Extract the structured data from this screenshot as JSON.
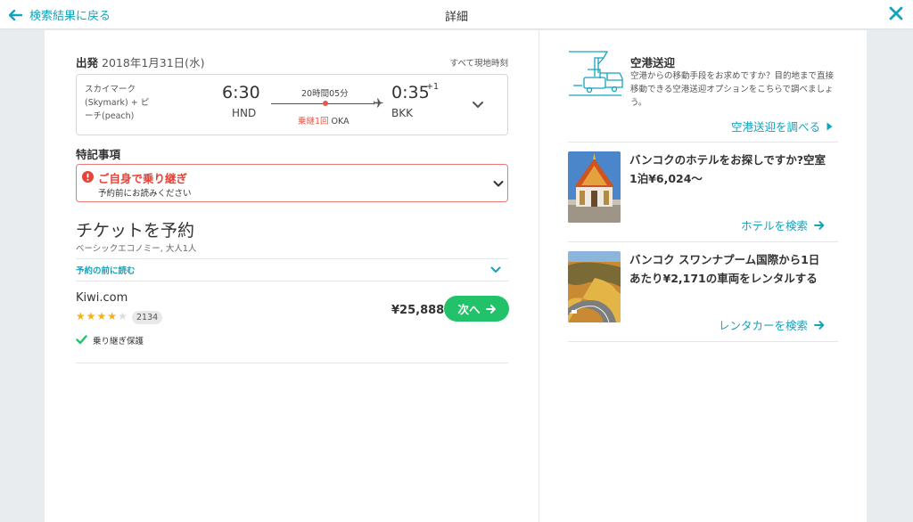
{
  "header": {
    "back_label": "検索結果に戻る",
    "title": "詳細"
  },
  "departure": {
    "label": "出発",
    "date": "2018年1月31日(水)",
    "local_time_note": "すべて現地時刻"
  },
  "flight": {
    "airline": "スカイマーク (Skymark) + ピーチ(peach)",
    "depart_time": "6:30",
    "depart_code": "HND",
    "duration": "20時間05分",
    "stops_label": "乗継1回",
    "stop_code": "OKA",
    "arrive_time": "0:35",
    "arrive_day_offset": "+1",
    "arrive_code": "BKK"
  },
  "notes": {
    "title": "特記事項",
    "warning_title": "ご自身で乗り継ぎ",
    "warning_sub": "予約前にお読みください"
  },
  "ticket": {
    "title": "チケットを予約",
    "subtitle": "ベーシックエコノミー, 大人1人",
    "read_before": "予約の前に読む"
  },
  "offer": {
    "vendor": "Kiwi.com",
    "rating": 4,
    "rating_max": 5,
    "review_count": "2134",
    "protection": "乗り継ぎ保護",
    "price": "¥25,888",
    "button": "次へ"
  },
  "sidebar": {
    "transfer": {
      "title": "空港送迎",
      "description": "空港からの移動手段をお求めですか？目的地まで直接移動できる空港送迎オプションをこちらで調べましょう。",
      "link": "空港送迎を調べる"
    },
    "hotel": {
      "text": "バンコクのホテルをお探しですか?空室1泊¥6,024〜",
      "link": "ホテルを検索"
    },
    "car": {
      "text": "バンコク スワンナプーム国際から1日あたり¥2,171の車両をレンタルする",
      "link": "レンタカーを検索"
    }
  },
  "colors": {
    "accent": "#14a3bd",
    "cta": "#22c26b",
    "warning": "#e4443a",
    "star": "#f2b01e"
  }
}
